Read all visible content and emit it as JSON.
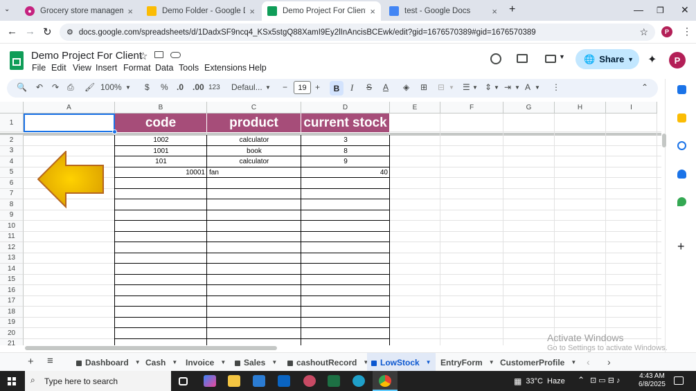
{
  "browser": {
    "tabs": [
      {
        "label": "Grocery store management Sp",
        "color": "#c5227f"
      },
      {
        "label": "Demo Folder - Google Drive",
        "color": "#1a73e8"
      },
      {
        "label": "Demo Project For Client - Goog",
        "color": "#0f9d58"
      },
      {
        "label": "test - Google Docs",
        "color": "#4285f4"
      }
    ],
    "url": "docs.google.com/spreadsheets/d/1DadxSF9ncq4_KSx5stgQ88XamI9Ey2lInAncisBCEwk/edit?gid=1676570389#gid=1676570389",
    "profile_initial": "P"
  },
  "doc": {
    "title": "Demo Project For Client",
    "menus": [
      "File",
      "Edit",
      "View",
      "Insert",
      "Format",
      "Data",
      "Tools",
      "Extensions",
      "Help"
    ],
    "share_label": "Share",
    "avatar_initial": "P"
  },
  "toolbar": {
    "zoom": "100%",
    "currency": "$",
    "percent": "%",
    "dec_decrease": ".0",
    "dec_increase": ".00",
    "num_format": "123",
    "font": "Defaul...",
    "font_size": "19",
    "bold": "B",
    "italic": "I",
    "strike": "S",
    "text_color": "A"
  },
  "grid": {
    "columns": [
      "A",
      "B",
      "C",
      "D",
      "E",
      "F",
      "G",
      "H",
      "I"
    ],
    "rows": [
      "1",
      "2",
      "3",
      "4",
      "5",
      "6",
      "7",
      "8",
      "9",
      "10",
      "11",
      "12",
      "13",
      "14",
      "15",
      "16",
      "17",
      "18",
      "19",
      "20",
      "21"
    ],
    "header": [
      "code",
      "product",
      "current stock"
    ],
    "data": [
      {
        "code": "1002",
        "product": "calculator",
        "stock": "3"
      },
      {
        "code": "1001",
        "product": "book",
        "stock": "8"
      },
      {
        "code": "101",
        "product": "calculator",
        "stock": "9"
      },
      {
        "code": "10001",
        "product": "fan",
        "stock": "40"
      }
    ],
    "header_color": "#a64d79",
    "arrow_color": "#e1a800"
  },
  "sheets": {
    "add_icon": "+",
    "tabs": [
      {
        "label": "Dashboard",
        "locked": true
      },
      {
        "label": "Cash",
        "locked": false
      },
      {
        "label": "Invoice",
        "locked": false
      },
      {
        "label": "Sales",
        "locked": true
      },
      {
        "label": "cashoutRecord",
        "locked": true
      },
      {
        "label": "LowStock",
        "locked": true,
        "active": true
      },
      {
        "label": "EntryForm",
        "locked": false
      },
      {
        "label": "CustomerProfile",
        "locked": false
      }
    ]
  },
  "watermark": {
    "line1": "Activate Windows",
    "line2": "Go to Settings to activate Windows."
  },
  "taskbar": {
    "search_placeholder": "Type here to search",
    "weather": "33°C  Haze",
    "time": "4:43 AM",
    "date": "6/8/2025"
  }
}
